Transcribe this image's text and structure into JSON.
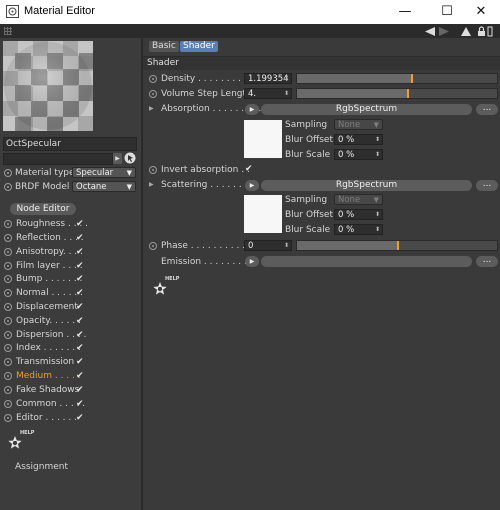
{
  "window": {
    "title": "Material Editor",
    "min": "—",
    "max": "☐",
    "close": "✕"
  },
  "left": {
    "material_name": "OctSpecular",
    "material_type_label": "Material type",
    "material_type_value": "Specular",
    "brdf_label": "BRDF Model",
    "brdf_value": "Octane",
    "node_editor": "Node Editor",
    "channels": [
      {
        "label": "Roughness",
        "dots": " . . . .",
        "checked": true,
        "highlight": false
      },
      {
        "label": "Reflection",
        "dots": " . . . .",
        "checked": true,
        "highlight": false
      },
      {
        "label": "Anisotropy",
        "dots": ". . . .",
        "checked": true,
        "highlight": false
      },
      {
        "label": "Film layer",
        "dots": " . . . .",
        "checked": true,
        "highlight": false
      },
      {
        "label": "Bump",
        "dots": " . . . . . . .",
        "checked": true,
        "highlight": false
      },
      {
        "label": "Normal",
        "dots": " . . . . . .",
        "checked": true,
        "highlight": false
      },
      {
        "label": "Displacement",
        "dots": "",
        "checked": true,
        "highlight": false
      },
      {
        "label": "Opacity",
        "dots": ". . . . . .",
        "checked": true,
        "highlight": false
      },
      {
        "label": "Dispersion",
        "dots": " . . . .",
        "checked": true,
        "highlight": false
      },
      {
        "label": "Index",
        "dots": " . . . . . . .",
        "checked": true,
        "highlight": false
      },
      {
        "label": "Transmission",
        "dots": "",
        "checked": true,
        "highlight": false
      },
      {
        "label": "Medium",
        "dots": " . . . . .",
        "checked": true,
        "highlight": true
      },
      {
        "label": "Fake Shadows",
        "dots": "",
        "checked": true,
        "highlight": false
      },
      {
        "label": "Common",
        "dots": " . . . . .",
        "checked": true,
        "highlight": false
      },
      {
        "label": "Editor",
        "dots": " . . . . . .",
        "checked": true,
        "highlight": false
      }
    ],
    "help_label": "HELP",
    "assignment": "Assignment"
  },
  "right": {
    "tabs": [
      "Basic",
      "Shader"
    ],
    "section": "Shader",
    "density_label": "Density",
    "density_dots": " . . . . . . . . . . .",
    "density_value": "1.199354",
    "density_slider": 0.57,
    "volume_label": "Volume Step Length",
    "volume_value": "4.",
    "volume_slider": 0.55,
    "absorption_label": "Absorption",
    "absorption_dots": " . . . . . . . . .",
    "absorption_shader": "RgbSpectrum",
    "absorption_sampling_label": "Sampling",
    "absorption_sampling_value": "None",
    "absorption_blur_offset_label": "Blur Offset",
    "absorption_blur_offset_value": "0 %",
    "absorption_blur_scale_label": "Blur Scale",
    "absorption_blur_scale_value": "0 %",
    "invert_label": "Invert absorption",
    "invert_dots": " . .",
    "invert_checked": "✔",
    "scattering_label": "Scattering",
    "scattering_dots": " . . . . . . . . .",
    "scattering_shader": "RgbSpectrum",
    "scattering_sampling_label": "Sampling",
    "scattering_sampling_value": "None",
    "scattering_blur_offset_label": "Blur Offset",
    "scattering_blur_offset_value": "0 %",
    "scattering_blur_scale_label": "Blur Scale",
    "scattering_blur_scale_value": "0 %",
    "phase_label": "Phase",
    "phase_dots": " . . . . . . . . . . . .",
    "phase_value": "0",
    "phase_slider": 0.5,
    "emission_label": "Emission",
    "emission_dots": " . . . . . . . . . .",
    "help_label": "HELP",
    "more_button": "..."
  },
  "colors": {
    "accent": "#f0a020",
    "highlight_text": "#f0a020",
    "tab_active": "#5b7fb0"
  }
}
